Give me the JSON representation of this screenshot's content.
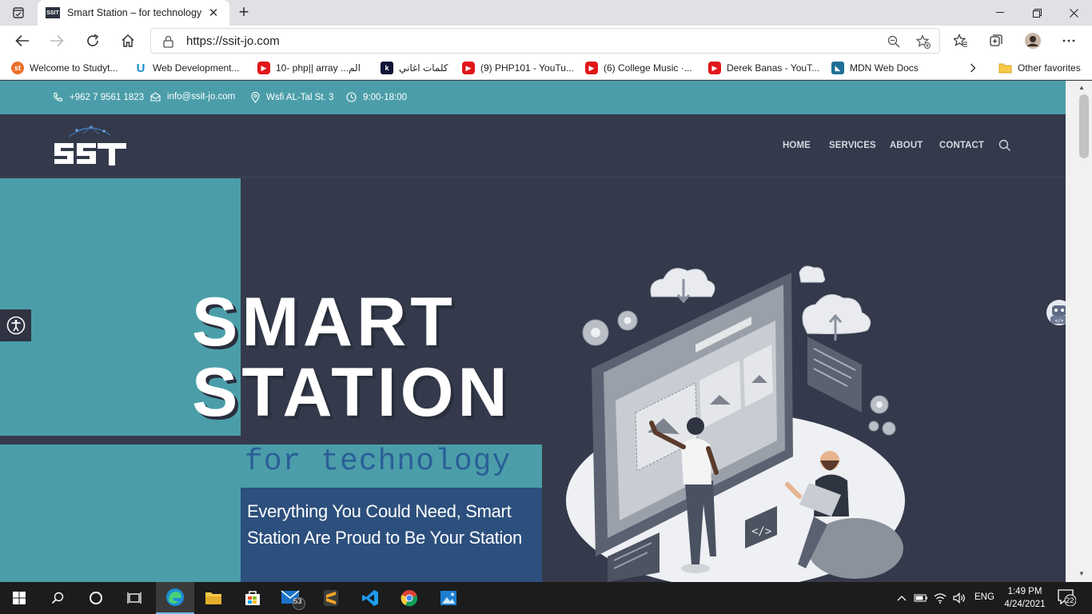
{
  "browser": {
    "tab_title": "Smart Station – for technology",
    "favicon_text": "SSIT",
    "url": "https://ssit-jo.com",
    "favorites": [
      {
        "label": "Welcome to Studyt...",
        "icon": "studytonight-icon"
      },
      {
        "label": "Web Development...",
        "icon": "udemy-icon"
      },
      {
        "label": "10- php|| array ...الم",
        "icon": "youtube-icon"
      },
      {
        "label": "كلمات اغاني",
        "icon": "k-icon"
      },
      {
        "label": "(9) PHP101 - YouTu...",
        "icon": "youtube-icon"
      },
      {
        "label": "(6) College Music ·...",
        "icon": "youtube-icon"
      },
      {
        "label": "Derek Banas - YouT...",
        "icon": "youtube-icon"
      },
      {
        "label": "MDN Web Docs",
        "icon": "mdn-icon"
      }
    ],
    "other_favorites": "Other favorites"
  },
  "site": {
    "topbar": {
      "phone": "+962 7 9561 1823",
      "email": "info@ssit-jo.com",
      "address": "Wsfi AL-Tal St. 3",
      "hours": "9:00-18:00"
    },
    "menu": [
      "HOME",
      "SERVICES",
      "ABOUT",
      "CONTACT"
    ],
    "hero": {
      "title_line1": "SMART",
      "title_line2": "STATION",
      "subtitle": "for technology",
      "description": "Everything You Could Need, Smart Station Are Proud to Be Your Station"
    }
  },
  "taskbar": {
    "mail_badge": "53",
    "language": "ENG",
    "time": "1:49 PM",
    "date": "4/24/2021",
    "notifications": "22"
  },
  "colors": {
    "teal": "#4b9ea9",
    "navy": "#343a4b",
    "blue_box": "#2c4f7d",
    "subtitle_blue": "#2a5f97"
  }
}
